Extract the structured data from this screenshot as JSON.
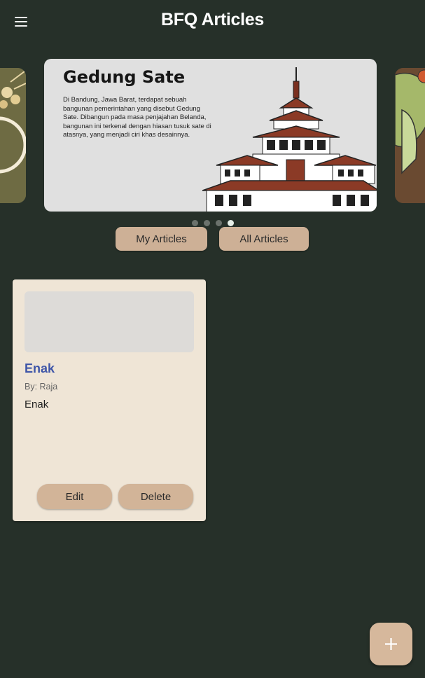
{
  "app": {
    "title": "BFQ Articles",
    "menu_icon": "hamburger-menu-icon",
    "background": "#263029"
  },
  "carousel": {
    "slide": {
      "title": "Gedung Sate",
      "body": "Di Bandung, Jawa Barat, terdapat sebuah bangunan pemerintahan yang disebut Gedung Sate. Dibangun pada masa penjajahan Belanda, bangunan ini terkenal dengan hiasan tusuk sate di atasnya, yang menjadi ciri khas desainnya."
    },
    "page_count": 4,
    "active_index": 3
  },
  "filters": {
    "my_articles": "My Articles",
    "all_articles": "All Articles"
  },
  "articles": [
    {
      "title": "Enak",
      "author": "By: Raja",
      "content": "Enak",
      "edit_label": "Edit",
      "delete_label": "Delete"
    }
  ],
  "fab": {
    "icon": "plus-icon"
  },
  "colors": {
    "accent": "#cdb096",
    "card_bg": "#efe5d6",
    "title_blue": "#3f56a8"
  }
}
